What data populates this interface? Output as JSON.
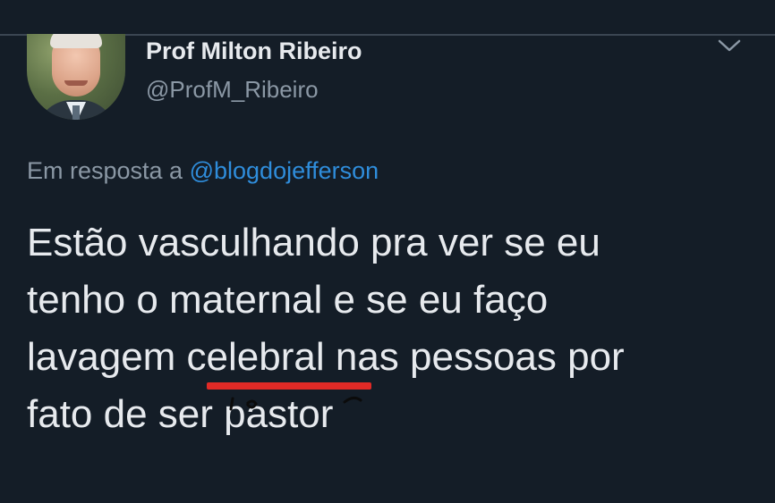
{
  "tweet": {
    "author_name": "Prof Milton Ribeiro",
    "author_handle": "@ProfM_Ribeiro",
    "reply_prefix": "Em resposta a",
    "reply_mention": "@blogdojefferson",
    "text_lines": [
      "Estão vasculhando pra ver se eu",
      "tenho o maternal e se eu faço",
      "lavagem celebral nas pessoas por",
      "fato de ser pastor"
    ]
  },
  "icons": {
    "menu": "chevron-down-icon",
    "avatar": "profile-photo"
  },
  "colors": {
    "background": "#141d27",
    "text_primary": "#e7eaee",
    "text_secondary": "#8b98a5",
    "link": "#2f8ddb",
    "highlight_underline": "#e12a26"
  }
}
